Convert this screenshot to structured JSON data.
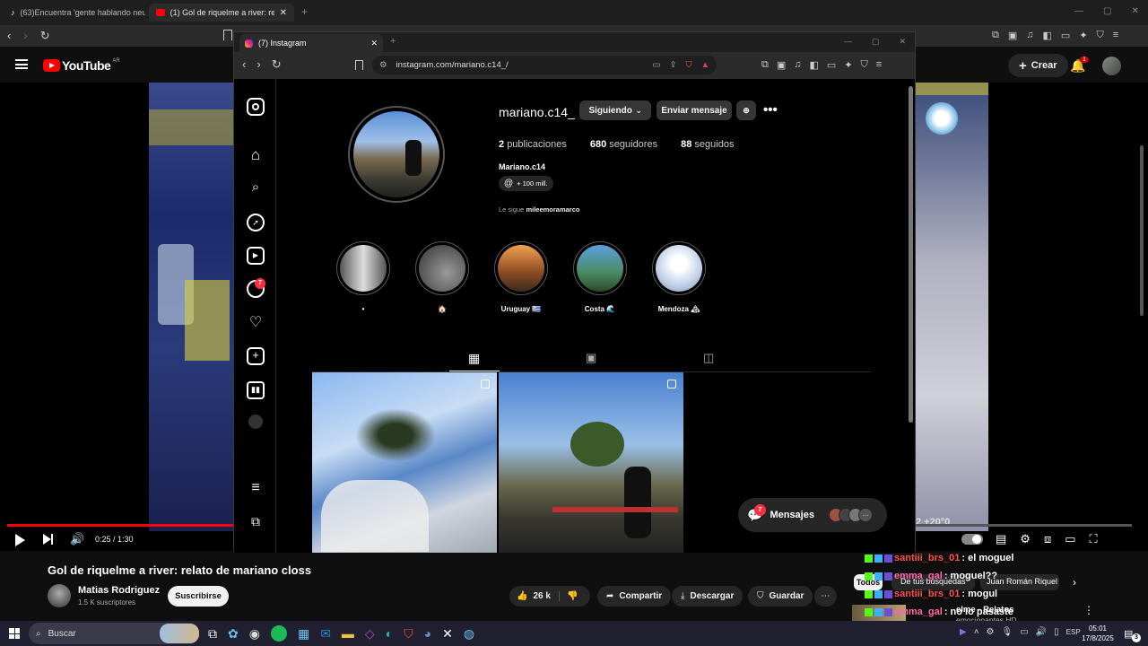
{
  "outer_tabs": [
    {
      "label": "(63)Encuentra 'gente hablando neutr",
      "icon": "tiktok-icon"
    },
    {
      "label": "(1) Gol de riquelme a river: relato",
      "icon": "youtube-icon"
    }
  ],
  "youtube": {
    "logo": "YouTube",
    "region": "AR",
    "create_label": "Crear",
    "notif_count": "1",
    "time": "0:25 / 1:30",
    "title": "Gol de riquelme a river: relato de mariano closs",
    "channel": "Matias Rodriguez",
    "subs": "1.5 K suscriptores",
    "subscribe": "Suscribirse",
    "likes": "26 k",
    "share": "Compartir",
    "download": "Descargar",
    "save": "Guardar",
    "filter_all": "Todos",
    "filter_search": "De tus búsquedas",
    "filter_jr": "Juan Román Riquel",
    "rec_title": "elme - Relatos",
    "rec_sub": "emocionantes HD",
    "overlay_text": "2 +20°0",
    "progress_fraction": 0.28
  },
  "chat": [
    {
      "user": "santiii_brs_01",
      "msg": " : el moguel",
      "color": "#ff4d4d"
    },
    {
      "user": "emma_gal",
      "msg": " : moguel??",
      "color": "#ff66aa"
    },
    {
      "user": "santiii_brs_01",
      "msg": " : mogul",
      "color": "#ff4d4d"
    },
    {
      "user": "emma_gal",
      "msg": " : no lo pasaste",
      "color": "#ff66aa"
    }
  ],
  "instagram": {
    "tab_label": "(7) Instagram",
    "url": "instagram.com/mariano.c14_/",
    "username": "mariano.c14_",
    "following_btn": "Siguiendo",
    "message_btn": "Enviar mensaje",
    "posts_count": "2",
    "posts_label": "publicaciones",
    "followers_count": "680",
    "followers_label": "seguidores",
    "following_count": "88",
    "following_label": "seguidos",
    "display_name": "Mariano.c14",
    "threads_badge": "+ 100 mill.",
    "followed_by_prefix": "Le sigue ",
    "followed_by_user": "mileemoramarco",
    "messages_label": "Mensajes",
    "messages_badge": "7",
    "notif_badge": "7",
    "highlights": [
      {
        "label": "•",
        "colors": [
          "#ddd",
          "#555"
        ]
      },
      {
        "label": "🏠",
        "colors": [
          "#777",
          "#333"
        ]
      },
      {
        "label": "Uruguay 🇺🇾",
        "colors": [
          "#d98a4a",
          "#3a2a20"
        ]
      },
      {
        "label": "Costa 🌊",
        "colors": [
          "#4a8fd0",
          "#2a5a30"
        ]
      },
      {
        "label": "Mendoza 🏔",
        "colors": [
          "#c0d0e8",
          "#eee"
        ]
      }
    ]
  },
  "taskbar": {
    "search": "Buscar",
    "lang": "ESP",
    "time": "05:01",
    "date": "17/8/2025",
    "notif": "3"
  }
}
